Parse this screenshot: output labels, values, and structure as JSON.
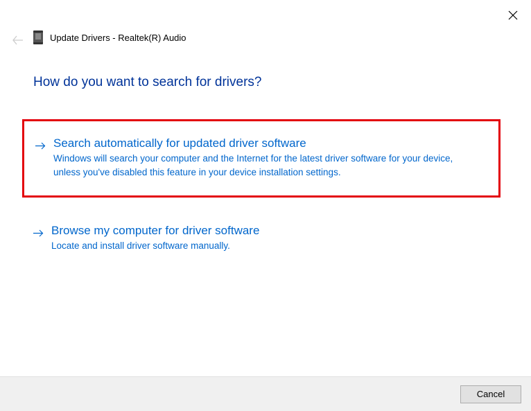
{
  "header": {
    "title": "Update Drivers - Realtek(R) Audio"
  },
  "main": {
    "heading": "How do you want to search for drivers?"
  },
  "options": [
    {
      "title": "Search automatically for updated driver software",
      "description": "Windows will search your computer and the Internet for the latest driver software for your device, unless you've disabled this feature in your device installation settings."
    },
    {
      "title": "Browse my computer for driver software",
      "description": "Locate and install driver software manually."
    }
  ],
  "footer": {
    "cancel_label": "Cancel"
  }
}
